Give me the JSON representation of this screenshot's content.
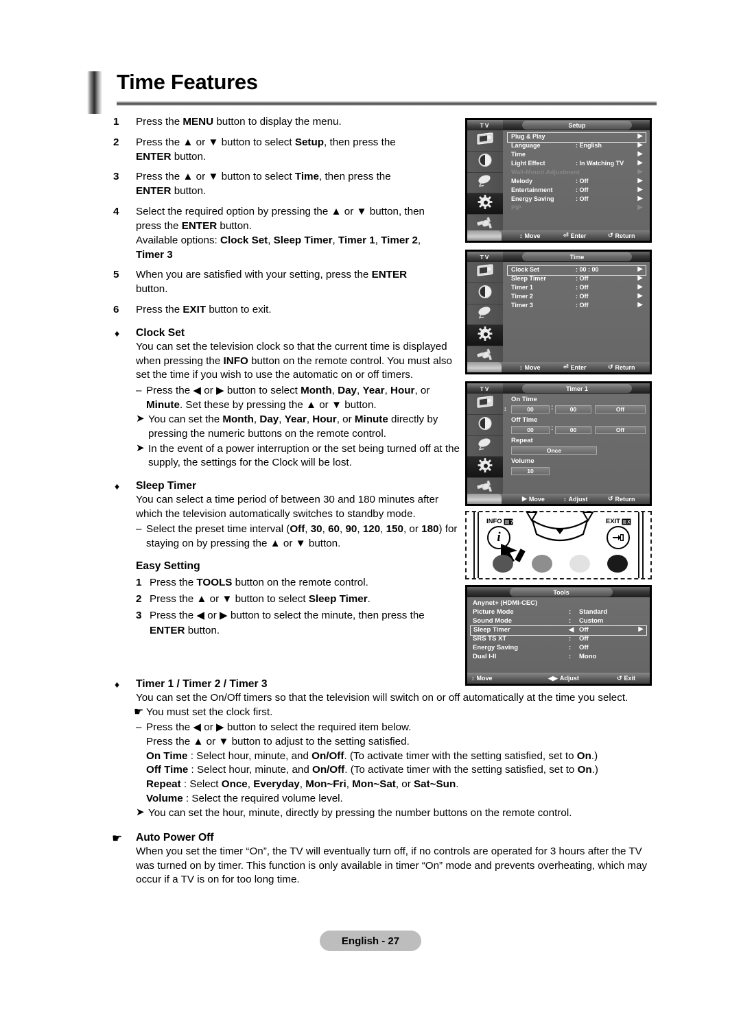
{
  "page": {
    "title": "Time Features",
    "footer_label": "English - 27"
  },
  "steps": [
    {
      "num": "1",
      "html": "Press the <b>MENU</b> button to display the menu."
    },
    {
      "num": "2",
      "html": "Press the ▲ or ▼ button to select <b>Setup</b>, then press the<br><b>ENTER</b> button."
    },
    {
      "num": "3",
      "html": "Press the ▲ or ▼ button to select <b>Time</b>, then press the<br><b>ENTER</b> button."
    },
    {
      "num": "4",
      "html": "Select the required option by pressing the ▲ or ▼ button, then<br>press the <b>ENTER</b> button.<br>Available options: <b>Clock Set</b>, <b>Sleep Timer</b>, <b>Timer 1</b>, <b>Timer 2</b>,<br><b>Timer 3</b>"
    },
    {
      "num": "5",
      "html": "When you are satisfied with your setting, press the <b>ENTER</b><br>button."
    },
    {
      "num": "6",
      "html": "Press the <b>EXIT</b> button to exit."
    }
  ],
  "clock_set": {
    "marker": "♦",
    "heading": "Clock Set",
    "body": "You can set the television clock so that the current time is displayed when pressing the <b>INFO</b> button on the remote control. You must also set the time if you wish to use the automatic on or off timers.",
    "dash1": "Press the ◀ or ▶ button to select <b>Month</b>, <b>Day</b>, <b>Year</b>, <b>Hour</b>, or <b>Minute</b>. Set these by pressing the ▲ or ▼ button.",
    "note1": "You can set the <b>Month</b>, <b>Day</b>, <b>Year</b>, <b>Hour</b>, or <b>Minute</b> directly by pressing the numeric buttons on the remote control.",
    "note2": "In the event of a power interruption or the set being turned off at the supply, the settings for the Clock will be lost."
  },
  "sleep_timer": {
    "marker": "♦",
    "heading": "Sleep Timer",
    "body": "You can select a time period of between 30 and 180 minutes after which the television automatically switches to standby mode.",
    "dash1": "Select the preset time interval (<b>Off</b>, <b>30</b>, <b>60</b>, <b>90</b>, <b>120</b>, <b>150</b>, or <b>180</b>) for staying on by pressing the ▲ or ▼ button."
  },
  "easy_setting": {
    "heading": "Easy Setting",
    "steps": [
      {
        "num": "1",
        "html": "Press the <b>TOOLS</b> button on the remote control."
      },
      {
        "num": "2",
        "html": "Press the ▲ or ▼ button to select <b>Sleep Timer</b>."
      },
      {
        "num": "3",
        "html": "Press the ◀ or ▶ button to select the minute, then press the<br><b>ENTER</b> button."
      }
    ]
  },
  "timers": {
    "marker": "♦",
    "heading": "Timer 1 / Timer 2 / Timer 3",
    "body": "You can set the On/Off timers so that the television will switch on or off automatically at the time you select.",
    "hand_note": "You must set the clock first.",
    "dash1": "Press the ◀ or ▶ button to select the required item below.",
    "dash1b": "Press the ▲ or ▼ button to adjust to the setting satisfied.",
    "on_time": "<b>On Time</b> : Select hour, minute, and <b>On/Off</b>. (To activate timer with the setting satisfied, set to <b>On</b>.)",
    "off_time": "<b>Off Time</b> : Select hour, minute, and <b>On/Off</b>. (To activate timer with the setting satisfied, set to <b>On</b>.)",
    "repeat": "<b>Repeat</b> : Select <b>Once</b>, <b>Everyday</b>, <b>Mon~Fri</b>, <b>Mon~Sat</b>, or <b>Sat~Sun</b>.",
    "volume": "<b>Volume</b> : Select the required volume level.",
    "note1": "You can set the hour, minute, directly by pressing the number buttons on the remote control."
  },
  "auto_power_off": {
    "marker": "☛",
    "heading": "Auto Power Off",
    "body": "When you set the timer “On”, the TV will eventually turn off, if no controls are operated for 3 hours after the TV was turned on by timer. This function is only available in timer “On” mode and prevents overheating, which may occur if a TV is on for too long time."
  },
  "osd": {
    "tv_label": "TV",
    "setup": {
      "title": "Setup",
      "rows": [
        {
          "label": "Plug & Play",
          "value": "",
          "dim": false,
          "highlight": true,
          "arrow": "▶"
        },
        {
          "label": "Language",
          "value": ": English",
          "dim": false,
          "highlight": false,
          "arrow": "▶"
        },
        {
          "label": "Time",
          "value": "",
          "dim": false,
          "highlight": false,
          "arrow": "▶"
        },
        {
          "label": "Light Effect",
          "value": ": In Watching TV",
          "dim": false,
          "highlight": false,
          "arrow": "▶"
        },
        {
          "label": "Wall-Mount Adjustment",
          "value": "",
          "dim": true,
          "highlight": false,
          "arrow": "▶"
        },
        {
          "label": "Melody",
          "value": ": Off",
          "dim": false,
          "highlight": false,
          "arrow": "▶"
        },
        {
          "label": "Entertainment",
          "value": ": Off",
          "dim": false,
          "highlight": false,
          "arrow": "▶"
        },
        {
          "label": "Energy Saving",
          "value": ": Off",
          "dim": false,
          "highlight": false,
          "arrow": "▶"
        },
        {
          "label": "PIP",
          "value": "",
          "dim": true,
          "highlight": false,
          "arrow": "▶"
        }
      ],
      "footer": [
        {
          "icon": "↕",
          "label": "Move"
        },
        {
          "icon": "⏎",
          "label": "Enter"
        },
        {
          "icon": "↺",
          "label": "Return"
        }
      ]
    },
    "time": {
      "title": "Time",
      "rows": [
        {
          "label": "Clock Set",
          "value": ": 00 : 00",
          "dim": false,
          "highlight": true,
          "arrow": "▶"
        },
        {
          "label": "Sleep Timer",
          "value": ": Off",
          "dim": false,
          "highlight": false,
          "arrow": "▶"
        },
        {
          "label": "Timer 1",
          "value": ": Off",
          "dim": false,
          "highlight": false,
          "arrow": "▶"
        },
        {
          "label": "Timer 2",
          "value": ": Off",
          "dim": false,
          "highlight": false,
          "arrow": "▶"
        },
        {
          "label": "Timer 3",
          "value": ": Off",
          "dim": false,
          "highlight": false,
          "arrow": "▶"
        }
      ],
      "footer": [
        {
          "icon": "↕",
          "label": "Move"
        },
        {
          "icon": "⏎",
          "label": "Enter"
        },
        {
          "icon": "↺",
          "label": "Return"
        }
      ]
    },
    "timer1": {
      "title": "Timer 1",
      "on_time_label": "On Time",
      "on_hour": "00",
      "on_min": "00",
      "on_state": "Off",
      "off_time_label": "Off Time",
      "off_hour": "00",
      "off_min": "00",
      "off_state": "Off",
      "repeat_label": "Repeat",
      "repeat_value": "Once",
      "volume_label": "Volume",
      "volume_value": "10",
      "footer": [
        {
          "icon": "▶",
          "label": "Move"
        },
        {
          "icon": "↕",
          "label": "Adjust"
        },
        {
          "icon": "↺",
          "label": "Return"
        }
      ]
    },
    "tools": {
      "title": "Tools",
      "rows": [
        {
          "label": "Anynet+ (HDMI-CEC)",
          "colon": "",
          "value": "",
          "highlight": false,
          "left_arrow": "",
          "right_arrow": ""
        },
        {
          "label": "Picture Mode",
          "colon": ":",
          "value": "Standard",
          "highlight": false,
          "left_arrow": "",
          "right_arrow": ""
        },
        {
          "label": "Sound Mode",
          "colon": ":",
          "value": "Custom",
          "highlight": false,
          "left_arrow": "",
          "right_arrow": ""
        },
        {
          "label": "Sleep Timer",
          "colon": "",
          "value": "Off",
          "highlight": true,
          "left_arrow": "◀",
          "right_arrow": "▶"
        },
        {
          "label": "SRS TS XT",
          "colon": ":",
          "value": "Off",
          "highlight": false,
          "left_arrow": "",
          "right_arrow": ""
        },
        {
          "label": "Energy Saving",
          "colon": ":",
          "value": "Off",
          "highlight": false,
          "left_arrow": "",
          "right_arrow": ""
        },
        {
          "label": "Dual I-II",
          "colon": ":",
          "value": "Mono",
          "highlight": false,
          "left_arrow": "",
          "right_arrow": ""
        }
      ],
      "footer": [
        {
          "icon": "↕",
          "label": "Move"
        },
        {
          "icon": "◀▶",
          "label": "Adjust"
        },
        {
          "icon": "↺",
          "label": "Exit"
        }
      ]
    },
    "remote": {
      "info_label": "INFO",
      "exit_label": "EXIT",
      "info_glyph": "i",
      "button_colors": [
        "#555555",
        "#8e8e8e",
        "#e2e2e2",
        "#1a1a1a"
      ]
    }
  }
}
